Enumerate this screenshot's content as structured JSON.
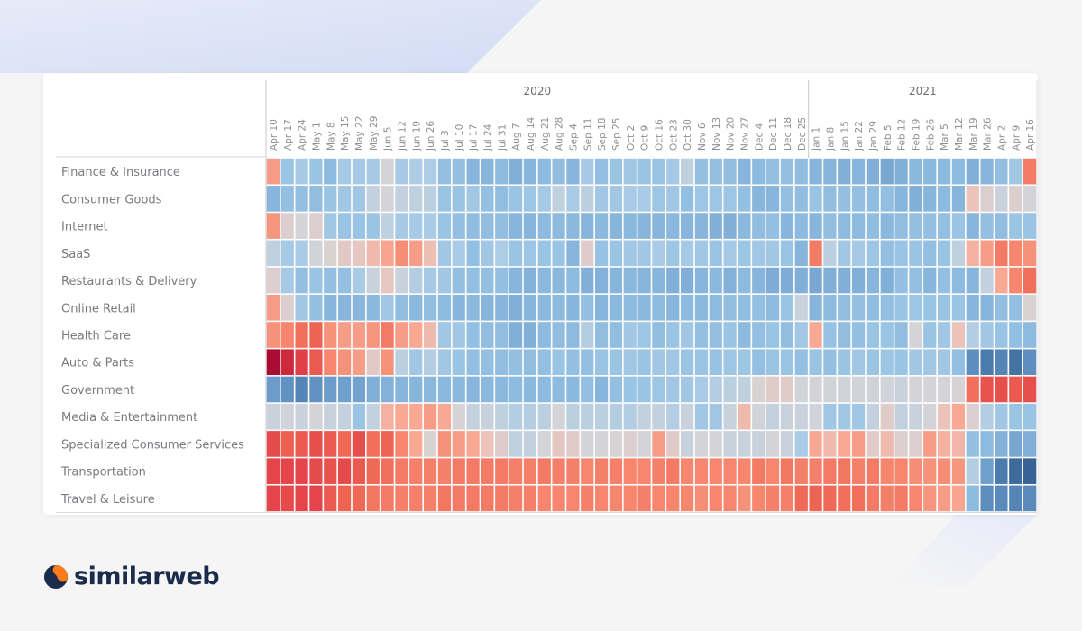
{
  "brand": {
    "name": "similarweb",
    "colors": {
      "dark": "#1b2b4b",
      "orange": "#ff7a1a"
    }
  },
  "chart_data": {
    "type": "heatmap",
    "title": "",
    "scale": {
      "type": "diverging",
      "min": -1,
      "max": 1,
      "low_color": "#2f5a8a",
      "mid_color": "#d4d4d8",
      "high_color": "#a80d34"
    },
    "year_groups": [
      {
        "label": "2020",
        "start": 0,
        "end": 37
      },
      {
        "label": "2021",
        "start": 38,
        "end": 53
      }
    ],
    "x": [
      "Apr 10",
      "Apr 17",
      "Apr 24",
      "May 1",
      "May 8",
      "May 15",
      "May 22",
      "May 29",
      "Jun 5",
      "Jun 12",
      "Jun 19",
      "Jun 26",
      "Jul 3",
      "Jul 10",
      "Jul 17",
      "Jul 24",
      "Jul 31",
      "Aug 7",
      "Aug 14",
      "Aug 21",
      "Aug 28",
      "Sep 4",
      "Sep 11",
      "Sep 18",
      "Sep 25",
      "Oct 2",
      "Oct 9",
      "Oct 16",
      "Oct 23",
      "Oct 30",
      "Nov 6",
      "Nov 13",
      "Nov 20",
      "Nov 27",
      "Dec 4",
      "Dec 11",
      "Dec 18",
      "Dec 25",
      "Jan 1",
      "Jan 8",
      "Jan 15",
      "Jan 22",
      "Jan 29",
      "Feb 5",
      "Feb 12",
      "Feb 19",
      "Feb 26",
      "Mar 5",
      "Mar 12",
      "Mar 19",
      "Mar 26",
      "Apr 2",
      "Apr 9",
      "Apr 16"
    ],
    "y": [
      "Finance & Insurance",
      "Consumer Goods",
      "Internet",
      "SaaS",
      "Restaurants & Delivery",
      "Online Retail",
      "Health Care",
      "Auto & Parts",
      "Government",
      "Media & Entertainment",
      "Specialized Consumer Services",
      "Transportation",
      "Travel & Leisure"
    ],
    "values": [
      [
        0.35,
        -0.3,
        -0.22,
        -0.3,
        -0.4,
        -0.22,
        -0.22,
        -0.22,
        0.0,
        -0.22,
        -0.18,
        -0.18,
        -0.35,
        -0.35,
        -0.45,
        -0.45,
        -0.4,
        -0.5,
        -0.45,
        -0.4,
        -0.38,
        -0.45,
        -0.22,
        -0.35,
        -0.3,
        -0.25,
        -0.3,
        -0.3,
        -0.22,
        -0.1,
        -0.35,
        -0.35,
        -0.38,
        -0.45,
        -0.4,
        -0.35,
        -0.35,
        -0.38,
        -0.45,
        -0.45,
        -0.5,
        -0.45,
        -0.5,
        -0.55,
        -0.5,
        -0.42,
        -0.42,
        -0.4,
        -0.4,
        -0.5,
        -0.45,
        -0.38,
        -0.25,
        0.5
      ],
      [
        -0.45,
        -0.35,
        -0.35,
        -0.38,
        -0.3,
        -0.25,
        -0.25,
        -0.08,
        0.0,
        -0.08,
        -0.1,
        -0.12,
        -0.3,
        -0.3,
        -0.25,
        -0.35,
        -0.38,
        -0.3,
        -0.28,
        -0.22,
        -0.1,
        -0.2,
        -0.12,
        -0.25,
        -0.25,
        -0.2,
        -0.2,
        -0.28,
        -0.25,
        -0.35,
        -0.28,
        -0.28,
        -0.28,
        -0.35,
        -0.45,
        -0.45,
        -0.35,
        -0.38,
        -0.3,
        -0.38,
        -0.35,
        -0.35,
        -0.38,
        -0.35,
        -0.45,
        -0.5,
        -0.45,
        -0.4,
        -0.45,
        0.15,
        0.05,
        -0.05,
        0.05,
        0.0
      ],
      [
        0.38,
        0.05,
        0.0,
        0.05,
        -0.25,
        -0.3,
        -0.3,
        -0.3,
        -0.1,
        -0.22,
        -0.22,
        -0.2,
        -0.3,
        -0.35,
        -0.38,
        -0.38,
        -0.38,
        -0.45,
        -0.45,
        -0.4,
        -0.4,
        -0.42,
        -0.45,
        -0.42,
        -0.45,
        -0.42,
        -0.45,
        -0.45,
        -0.42,
        -0.45,
        -0.45,
        -0.5,
        -0.5,
        -0.42,
        -0.38,
        -0.35,
        -0.45,
        -0.4,
        -0.45,
        -0.38,
        -0.4,
        -0.4,
        -0.38,
        -0.42,
        -0.38,
        -0.35,
        -0.35,
        -0.35,
        -0.3,
        -0.45,
        -0.35,
        -0.38,
        -0.3,
        -0.3
      ],
      [
        -0.1,
        -0.22,
        -0.2,
        -0.02,
        0.03,
        0.1,
        0.12,
        0.2,
        0.32,
        0.42,
        0.35,
        0.18,
        -0.25,
        -0.2,
        -0.35,
        -0.25,
        -0.18,
        -0.3,
        -0.28,
        -0.3,
        -0.3,
        -0.45,
        0.07,
        -0.32,
        -0.3,
        -0.25,
        -0.25,
        -0.2,
        -0.28,
        -0.22,
        -0.25,
        -0.3,
        -0.22,
        -0.28,
        -0.25,
        -0.25,
        -0.3,
        -0.45,
        0.5,
        -0.12,
        -0.25,
        -0.22,
        -0.28,
        -0.35,
        -0.3,
        -0.3,
        -0.35,
        -0.3,
        -0.1,
        0.25,
        0.35,
        0.5,
        0.45,
        0.4
      ],
      [
        0.05,
        -0.22,
        -0.35,
        -0.3,
        -0.35,
        -0.35,
        -0.2,
        -0.05,
        0.12,
        -0.05,
        -0.15,
        -0.22,
        -0.25,
        -0.35,
        -0.35,
        -0.35,
        -0.35,
        -0.45,
        -0.48,
        -0.42,
        -0.42,
        -0.4,
        -0.5,
        -0.48,
        -0.45,
        -0.42,
        -0.45,
        -0.45,
        -0.5,
        -0.5,
        -0.45,
        -0.42,
        -0.48,
        -0.4,
        -0.45,
        -0.52,
        -0.52,
        -0.5,
        -0.55,
        -0.5,
        -0.5,
        -0.5,
        -0.45,
        -0.5,
        -0.35,
        -0.35,
        -0.45,
        -0.35,
        -0.4,
        -0.45,
        -0.08,
        0.3,
        0.45,
        0.55
      ],
      [
        0.35,
        0.05,
        -0.25,
        -0.35,
        -0.45,
        -0.45,
        -0.45,
        -0.42,
        -0.25,
        -0.38,
        -0.42,
        -0.38,
        -0.4,
        -0.45,
        -0.42,
        -0.45,
        -0.45,
        -0.5,
        -0.45,
        -0.42,
        -0.4,
        -0.45,
        -0.35,
        -0.45,
        -0.42,
        -0.4,
        -0.42,
        -0.4,
        -0.45,
        -0.4,
        -0.42,
        -0.4,
        -0.38,
        -0.38,
        -0.35,
        -0.4,
        -0.3,
        -0.05,
        -0.45,
        -0.4,
        -0.38,
        -0.35,
        -0.38,
        -0.35,
        -0.3,
        -0.28,
        -0.3,
        -0.3,
        -0.3,
        -0.45,
        -0.45,
        -0.38,
        -0.35,
        0.03
      ],
      [
        0.4,
        0.45,
        0.55,
        0.6,
        0.4,
        0.35,
        0.35,
        0.38,
        0.5,
        0.35,
        0.3,
        0.2,
        -0.25,
        -0.25,
        -0.35,
        -0.38,
        -0.38,
        -0.5,
        -0.5,
        -0.4,
        -0.38,
        -0.4,
        -0.15,
        -0.38,
        -0.38,
        -0.25,
        -0.28,
        -0.38,
        -0.3,
        -0.25,
        -0.35,
        -0.35,
        -0.3,
        -0.4,
        -0.35,
        -0.3,
        -0.38,
        -0.25,
        0.3,
        -0.32,
        -0.38,
        -0.35,
        -0.3,
        -0.3,
        -0.38,
        0.0,
        -0.3,
        -0.25,
        0.15,
        -0.15,
        -0.25,
        -0.3,
        -0.35,
        -0.4
      ],
      [
        1.0,
        0.9,
        0.78,
        0.65,
        0.45,
        0.4,
        0.35,
        0.1,
        0.4,
        -0.12,
        -0.25,
        -0.15,
        -0.25,
        -0.3,
        -0.35,
        -0.35,
        -0.38,
        -0.35,
        -0.38,
        -0.35,
        -0.3,
        -0.35,
        -0.35,
        -0.3,
        -0.3,
        -0.25,
        -0.3,
        -0.25,
        -0.25,
        -0.3,
        -0.3,
        -0.32,
        -0.28,
        -0.28,
        -0.35,
        -0.3,
        -0.3,
        -0.35,
        -0.3,
        -0.35,
        -0.3,
        -0.25,
        -0.3,
        -0.28,
        -0.3,
        -0.25,
        -0.25,
        -0.25,
        -0.35,
        -0.7,
        -0.8,
        -0.75,
        -0.85,
        -0.7
      ],
      [
        -0.62,
        -0.68,
        -0.75,
        -0.68,
        -0.62,
        -0.6,
        -0.58,
        -0.5,
        -0.48,
        -0.45,
        -0.45,
        -0.42,
        -0.42,
        -0.42,
        -0.45,
        -0.42,
        -0.42,
        -0.4,
        -0.42,
        -0.4,
        -0.4,
        -0.42,
        -0.35,
        -0.45,
        -0.35,
        -0.3,
        -0.3,
        -0.28,
        -0.25,
        -0.25,
        -0.2,
        -0.15,
        -0.12,
        -0.1,
        0.03,
        0.08,
        0.08,
        -0.02,
        0.0,
        -0.02,
        -0.03,
        -0.02,
        -0.03,
        -0.02,
        -0.05,
        0.0,
        0.0,
        0.0,
        0.02,
        0.55,
        0.68,
        0.7,
        0.65,
        0.7
      ],
      [
        -0.05,
        -0.02,
        -0.05,
        0.0,
        -0.05,
        -0.08,
        -0.3,
        -0.08,
        0.25,
        0.3,
        0.3,
        0.35,
        0.3,
        0.02,
        -0.08,
        -0.05,
        -0.1,
        -0.15,
        -0.15,
        -0.12,
        0.0,
        -0.12,
        -0.12,
        -0.12,
        -0.15,
        -0.15,
        -0.08,
        -0.08,
        -0.15,
        -0.05,
        -0.25,
        -0.25,
        -0.05,
        0.2,
        -0.02,
        -0.08,
        -0.05,
        -0.05,
        -0.02,
        -0.25,
        -0.25,
        -0.25,
        -0.08,
        0.08,
        -0.08,
        -0.05,
        0.0,
        0.15,
        0.3,
        0.05,
        -0.15,
        -0.25,
        -0.3,
        -0.3
      ],
      [
        0.72,
        0.62,
        0.65,
        0.7,
        0.65,
        0.58,
        0.7,
        0.55,
        0.6,
        0.45,
        0.3,
        0.03,
        0.4,
        0.35,
        0.3,
        0.15,
        0.07,
        -0.1,
        -0.08,
        0.0,
        0.12,
        0.08,
        0.0,
        0.0,
        0.02,
        0.05,
        0.0,
        0.35,
        0.08,
        -0.05,
        0.0,
        0.0,
        -0.05,
        -0.05,
        -0.05,
        0.0,
        -0.05,
        -0.2,
        0.3,
        0.2,
        0.3,
        0.35,
        0.08,
        0.2,
        0.05,
        0.05,
        0.35,
        0.25,
        0.22,
        -0.35,
        -0.4,
        -0.48,
        -0.55,
        -0.5
      ],
      [
        0.75,
        0.75,
        0.75,
        0.72,
        0.68,
        0.72,
        0.65,
        0.58,
        0.55,
        0.5,
        0.48,
        0.48,
        0.48,
        0.5,
        0.5,
        0.5,
        0.5,
        0.48,
        0.48,
        0.5,
        0.48,
        0.48,
        0.45,
        0.48,
        0.48,
        0.45,
        0.45,
        0.48,
        0.5,
        0.45,
        0.45,
        0.45,
        0.45,
        0.45,
        0.5,
        0.45,
        0.52,
        0.48,
        0.48,
        0.5,
        0.52,
        0.48,
        0.5,
        0.45,
        0.45,
        0.42,
        0.4,
        0.42,
        0.38,
        -0.15,
        -0.6,
        -0.8,
        -0.9,
        -0.95
      ],
      [
        0.75,
        0.72,
        0.75,
        0.75,
        0.65,
        0.6,
        0.58,
        0.52,
        0.5,
        0.48,
        0.48,
        0.48,
        0.52,
        0.5,
        0.5,
        0.5,
        0.5,
        0.48,
        0.48,
        0.45,
        0.45,
        0.45,
        0.48,
        0.45,
        0.45,
        0.45,
        0.48,
        0.45,
        0.45,
        0.45,
        0.42,
        0.45,
        0.45,
        0.4,
        0.45,
        0.48,
        0.48,
        0.58,
        0.6,
        0.58,
        0.55,
        0.55,
        0.5,
        0.48,
        0.5,
        0.45,
        0.38,
        0.35,
        0.32,
        -0.4,
        -0.7,
        -0.72,
        -0.75,
        -0.72
      ]
    ]
  }
}
